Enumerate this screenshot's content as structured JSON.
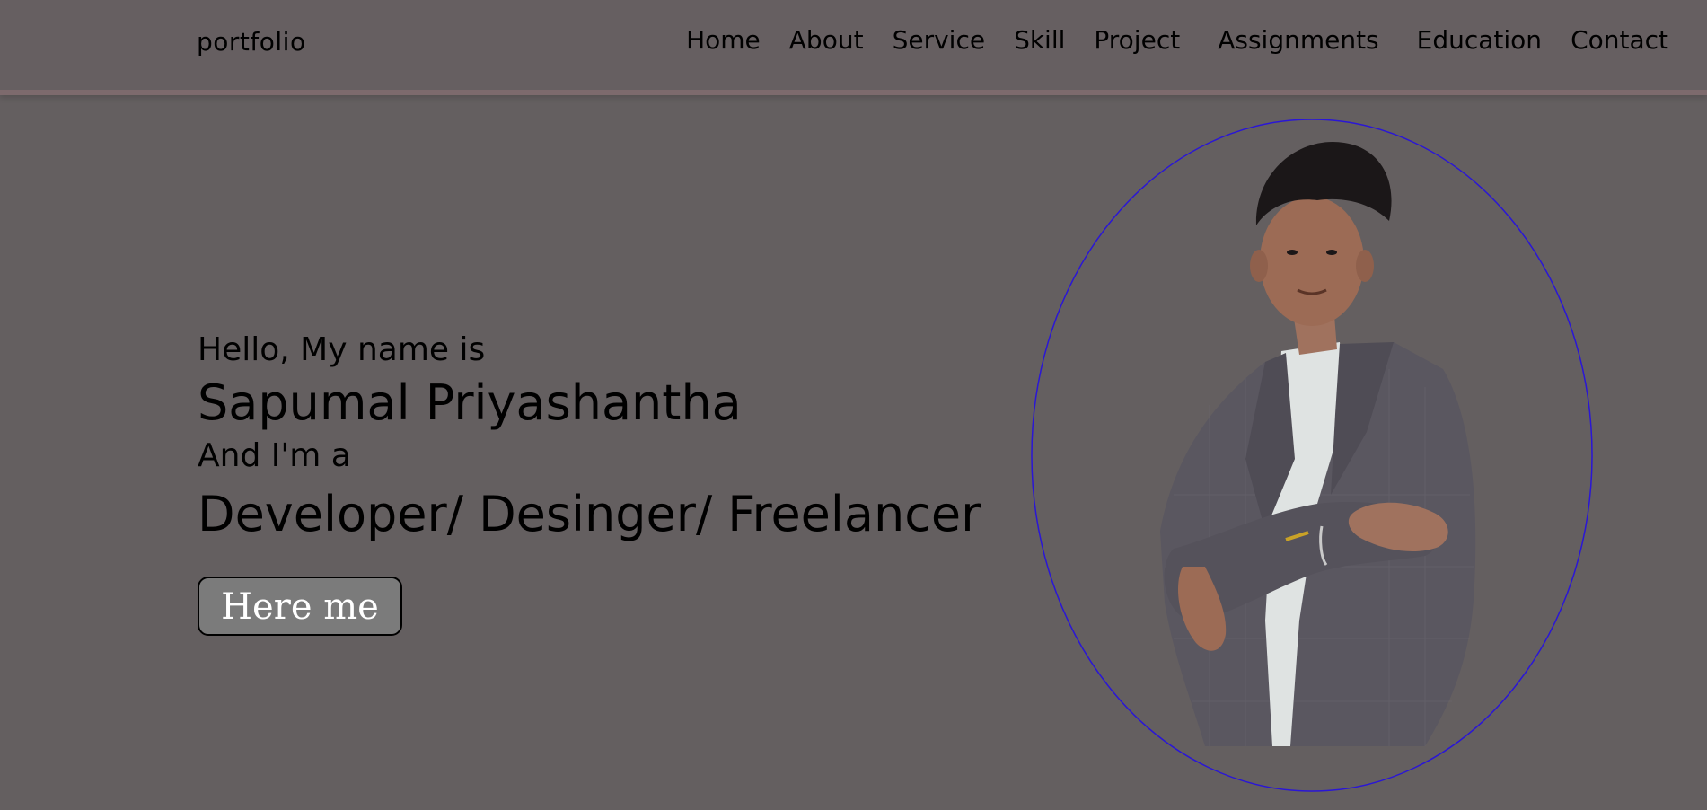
{
  "header": {
    "brand": "portfolio",
    "nav": [
      {
        "label": "Home"
      },
      {
        "label": "About"
      },
      {
        "label": "Service"
      },
      {
        "label": "Skill"
      },
      {
        "label": "Project"
      },
      {
        "label": "Assignments"
      },
      {
        "label": "Education"
      },
      {
        "label": "Contact"
      }
    ]
  },
  "hero": {
    "greeting": "Hello, My name is",
    "name": "Sapumal Priyashantha",
    "role_intro": "And I'm a",
    "roles": "Developer/ Desinger/ Freelancer",
    "button_label": "Here me"
  },
  "colors": {
    "background": "#645f60",
    "header_border": "#7d6a6d",
    "button_bg": "#7b7b7b",
    "ellipse_stroke": "#2a16d6"
  },
  "icons": {
    "portrait": "profile-photo"
  }
}
